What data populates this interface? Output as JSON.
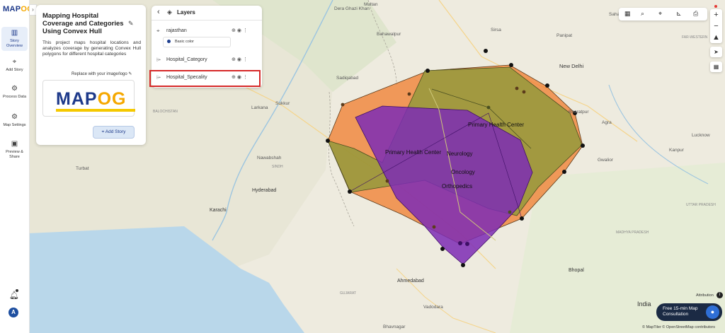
{
  "app": {
    "logo_left": "MAP",
    "logo_right": "OG"
  },
  "rail": {
    "items": [
      {
        "label": "Story Overview",
        "icon": "map-icon"
      },
      {
        "label": "Add Story",
        "icon": "pin-icon"
      },
      {
        "label": "Process Data",
        "icon": "process-icon"
      },
      {
        "label": "Map Settings",
        "icon": "gear-icon"
      },
      {
        "label": "Preview & Share",
        "icon": "preview-icon"
      }
    ],
    "avatar": "A"
  },
  "story": {
    "title": "Mapping Hospital Coverage and Categories Using Convex Hull",
    "description": "This project maps hospital locations and analyzes coverage by generating Convex Hull polygons for different hospital categories",
    "replace_label": "Replace with your image/logo",
    "logo_text_left": "MAP",
    "logo_text_right": "OG",
    "add_story_label": "Add Story"
  },
  "layers": {
    "title": "Layers",
    "items": [
      {
        "name": "rajasthan",
        "sub": "Basic color",
        "icon": "pin-icon"
      },
      {
        "name": "Hospital_Category",
        "icon": "polygon-icon"
      },
      {
        "name": "Hospital_Specality",
        "icon": "polygon-icon",
        "highlighted": true
      }
    ]
  },
  "map": {
    "places": [
      "Dera Ghazi Khan",
      "Multan",
      "Bahawalpur",
      "Sadiqabad",
      "Sukkur",
      "Larkana",
      "BALOCHISTAN",
      "Nawabshah",
      "SINDH",
      "Turbat",
      "Hyderabad",
      "Karachi",
      "Ahmedabad",
      "Vadodara",
      "Bhavnagar",
      "Bhopal",
      "India",
      "Kanpur",
      "Lucknow",
      "Gwalior",
      "Agra",
      "Bharatpur",
      "New Delhi",
      "Panipat",
      "Sirsa",
      "Saharanpur",
      "FAR-WESTERN",
      "UTTAR PRADESH",
      "MADHYA PRADESH",
      "GUJARAT"
    ],
    "polygon_labels": [
      "Primary Health Center",
      "Primary Health Center",
      "Neurology",
      "Oncology",
      "Orthopedics"
    ]
  },
  "controls": {
    "zoom_in": "+",
    "zoom_out": "−",
    "attribution": "Attribution",
    "consult": "Free 15-min Map Consultation",
    "copyright": "© MapTiler © OpenStreetMap contributors"
  },
  "colors": {
    "orange_hull": "#f07c2c",
    "olive_hull": "#8c9a3a",
    "purple_hull": "#7d2bb5",
    "brand": "#1e3a8a",
    "accent": "#f5a800"
  }
}
